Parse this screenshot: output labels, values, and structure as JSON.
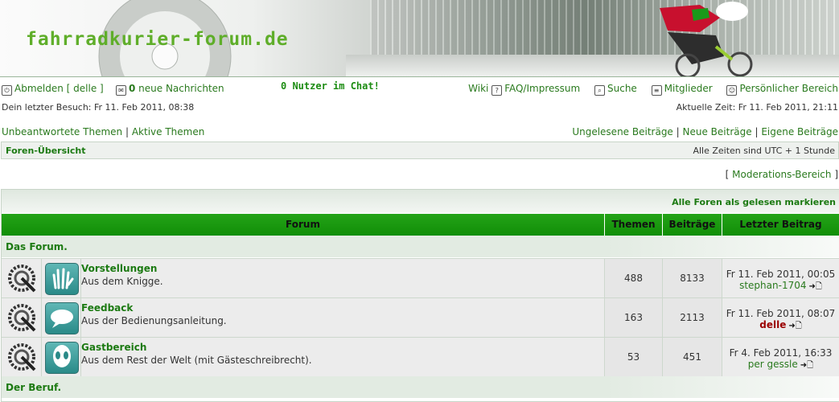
{
  "site": {
    "logo": "fahrradkurier-forum.de"
  },
  "nav": {
    "logout": "Abmelden [ delle ]",
    "pm_count": "0",
    "pm_label": "neue Nachrichten",
    "chat": "0 Nutzer im Chat!",
    "wiki": "Wiki",
    "faq": "FAQ/Impressum",
    "search": "Suche",
    "members": "Mitglieder",
    "personal": "Persönlicher Bereich"
  },
  "info": {
    "last_visit": "Dein letzter Besuch: Fr 11. Feb 2011, 08:38",
    "current_time": "Aktuelle Zeit: Fr 11. Feb 2011, 21:11"
  },
  "links": {
    "unanswered": "Unbeantwortete Themen",
    "active": "Aktive Themen",
    "unread": "Ungelesene Beiträge",
    "new": "Neue Beiträge",
    "own": "Eigene Beiträge"
  },
  "breadcrumb": {
    "index": "Foren-Übersicht",
    "timezone": "Alle Zeiten sind UTC + 1 Stunde"
  },
  "moderation": {
    "open": "[",
    "label": "Moderations-Bereich",
    "close": "]"
  },
  "table": {
    "mark_read": "Alle Foren als gelesen markieren",
    "headers": {
      "forum": "Forum",
      "topics": "Themen",
      "posts": "Beiträge",
      "last": "Letzter Beitrag"
    },
    "categories": [
      "Das Forum.",
      "Der Beruf."
    ],
    "forums": [
      {
        "name": "Vorstellungen",
        "desc": "Aus dem Knigge.",
        "topics": "488",
        "posts": "8133",
        "last_date": "Fr 11. Feb 2011, 00:05",
        "last_user": "stephan-1704",
        "icon": "hand-icon"
      },
      {
        "name": "Feedback",
        "desc": "Aus der Bedienungsanleitung.",
        "topics": "163",
        "posts": "2113",
        "last_date": "Fr 11. Feb 2011, 08:07",
        "last_user": "delle",
        "icon": "speech-bubble-icon"
      },
      {
        "name": "Gastbereich",
        "desc": "Aus dem Rest der Welt (mit Gästeschreibrecht).",
        "topics": "53",
        "posts": "451",
        "last_date": "Fr 4. Feb 2011, 16:33",
        "last_user": "per gessle",
        "icon": "alien-icon"
      }
    ]
  },
  "colors": {
    "accent": "#1c7a12",
    "header_green": "#18990c",
    "admin_red": "#9b0000"
  }
}
